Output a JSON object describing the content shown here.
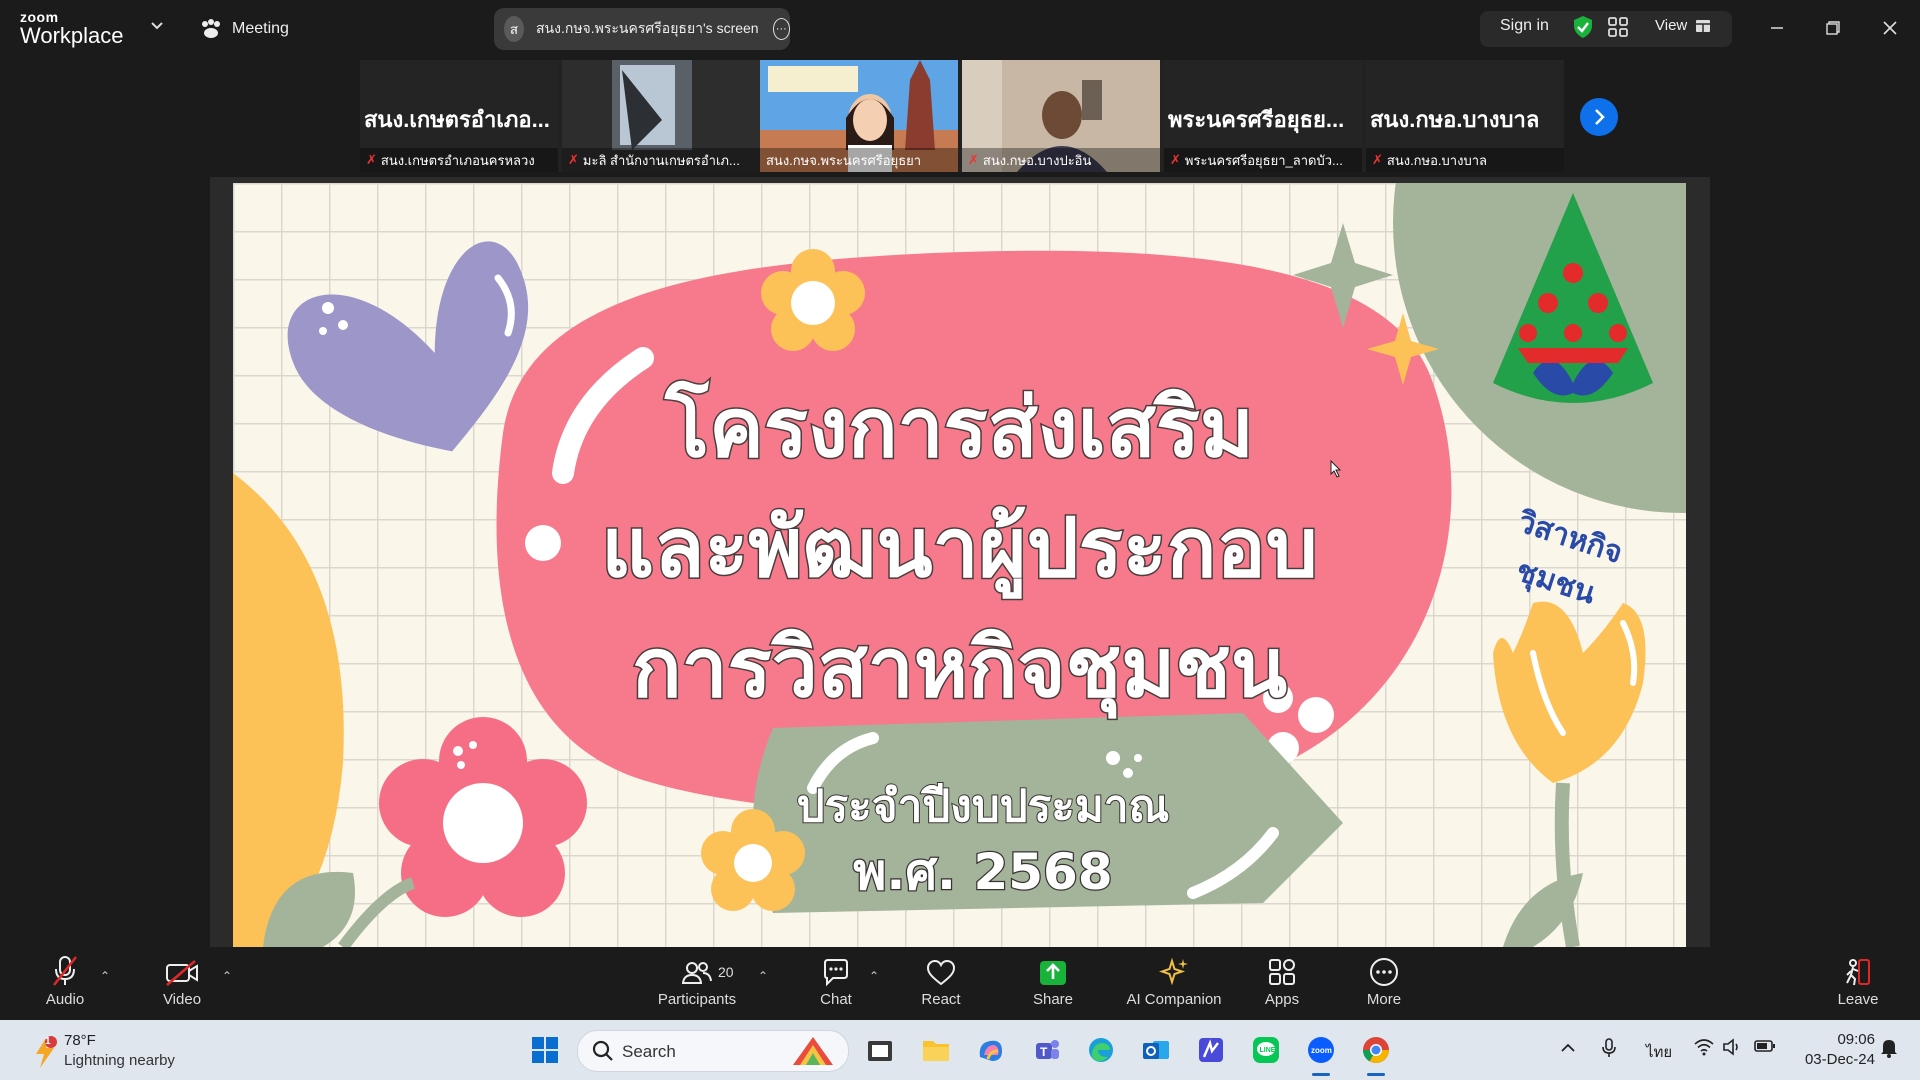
{
  "app": {
    "brand_small": "zoom",
    "brand_big": "Workplace",
    "meeting_label": "Meeting",
    "share_initial": "ส",
    "share_title": "สนง.กษจ.พระนครศรีอยุธยา's screen",
    "sign_in": "Sign in",
    "view_label": "View"
  },
  "icons": {
    "brand_chevron": "chevron-down-icon",
    "meeting": "paw-icon",
    "share_more": "ellipsis-icon",
    "security": "green-shield-check-icon",
    "gallery": "grid-icon",
    "view": "view-icon",
    "minimize": "minimize-icon",
    "restore": "restore-icon",
    "close": "close-icon",
    "strip_next": "chevron-right-icon",
    "mic_muted": "mic-off-icon"
  },
  "thumbnails": [
    {
      "big_label": "สนง.เกษตรอำเภอ...",
      "name": "สนง.เกษตรอำเภอนครหลวง",
      "active": false
    },
    {
      "big_label": "",
      "name": "มะลิ สำนักงานเกษตรอำเภ...",
      "active": false
    },
    {
      "big_label": "",
      "name": "สนง.กษจ.พระนครศรีอยุธยา",
      "active": true
    },
    {
      "big_label": "",
      "name": "สนง.กษอ.บางปะอิน",
      "active": false
    },
    {
      "big_label": "พระนครศรีอยุธย...",
      "name": "พระนครศรีอยุธยา_ลาดบัว...",
      "active": false
    },
    {
      "big_label": "สนง.กษอ.บางบาล",
      "name": "สนง.กษอ.บางบาล",
      "active": false
    }
  ],
  "slide": {
    "title_line1": "โครงการส่งเสริม",
    "title_line2": "และพัฒนาผู้ประกอบ",
    "title_line3": "การวิสาหกิจชุมชน",
    "subtitle1": "ประจำปีงบประมาณ",
    "subtitle2": "พ.ศ. 2568",
    "logo_text": "วิสาหกิจชุมชน",
    "colors": {
      "pink": "#f77a8c",
      "sage": "#a3b49a",
      "yellow": "#fcc257",
      "lavender": "#9c97c8",
      "cream": "#fbf6ea"
    }
  },
  "controls": {
    "audio": "Audio",
    "video": "Video",
    "participants": "Participants",
    "participant_count": "20",
    "chat": "Chat",
    "react": "React",
    "share": "Share",
    "ai_companion": "AI Companion",
    "apps": "Apps",
    "more": "More",
    "leave": "Leave",
    "share_color": "#19b23a",
    "leave_color": "#e02828"
  },
  "taskbar": {
    "weather_badge": "1",
    "temperature": "78°F",
    "weather_desc": "Lightning nearby",
    "search_label": "Search",
    "language": "ไทย",
    "time": "09:06",
    "date": "03-Dec-24",
    "apps": [
      "windows-start-icon",
      "file-explorer-icon",
      "folder-icon",
      "copilot-icon",
      "teams-icon",
      "edge-icon",
      "outlook-icon",
      "vpn-icon",
      "line-icon",
      "zoom-icon",
      "chrome-icon"
    ]
  }
}
